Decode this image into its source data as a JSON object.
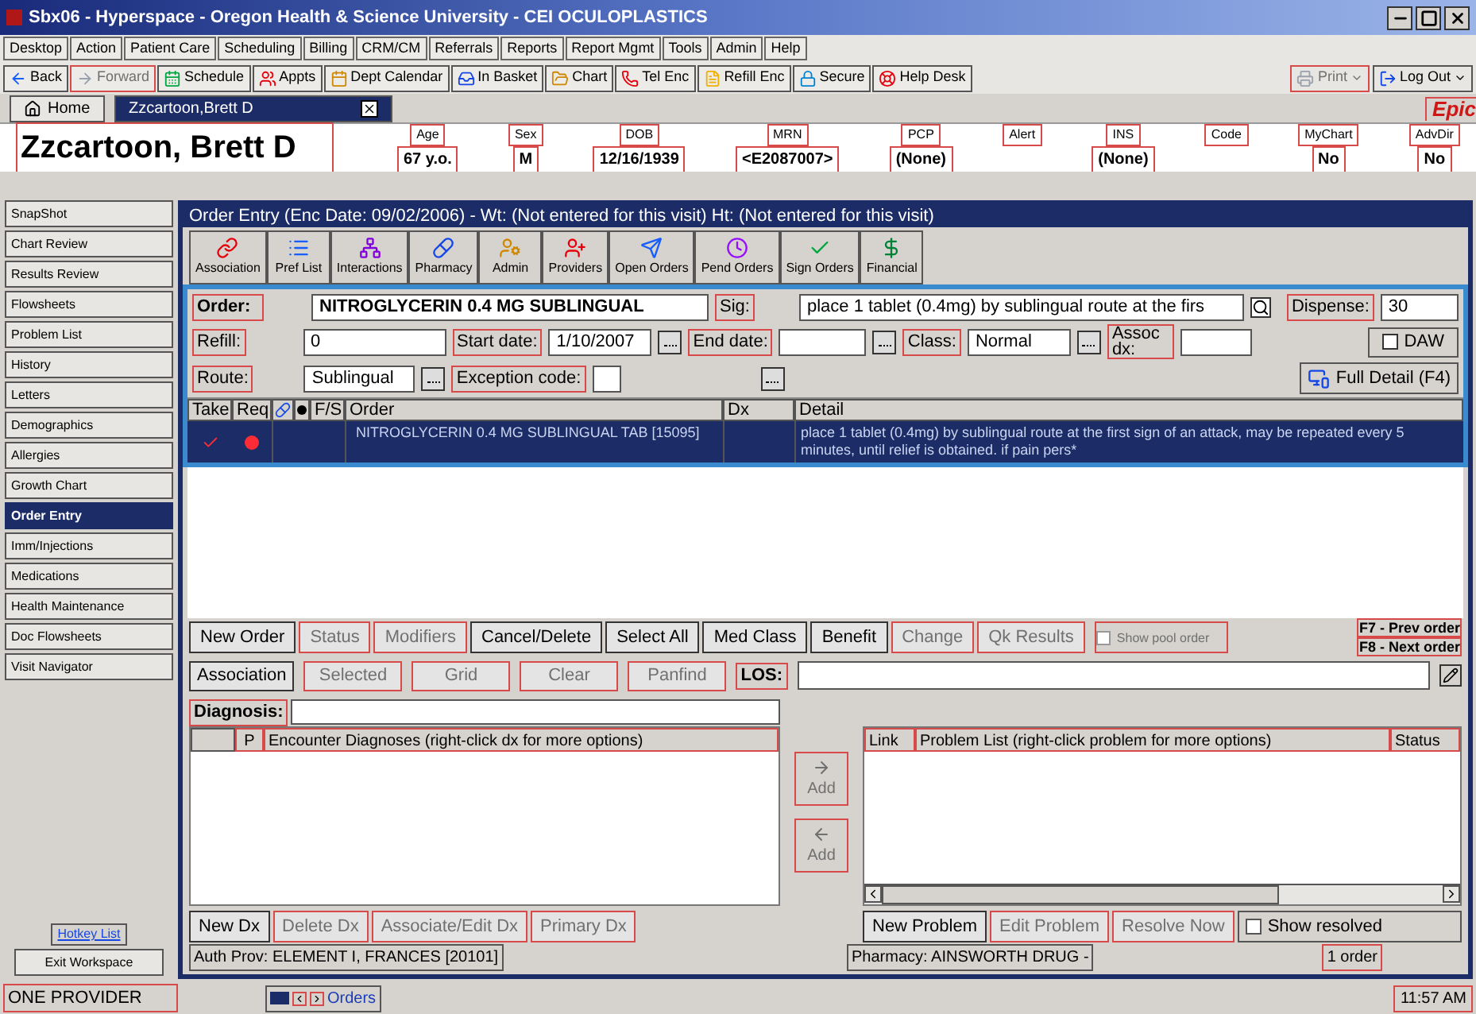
{
  "window": {
    "title": "Sbx06 - Hyperspace - Oregon Health & Science University - CEI OCULOPLASTICS"
  },
  "menu": [
    "Desktop",
    "Action",
    "Patient Care",
    "Scheduling",
    "Billing",
    "CRM/CM",
    "Referrals",
    "Reports",
    "Report Mgmt",
    "Tools",
    "Admin",
    "Help"
  ],
  "toolbar": [
    {
      "label": "Back",
      "disabled": false
    },
    {
      "label": "Forward",
      "disabled": true
    },
    {
      "label": "Schedule",
      "disabled": false
    },
    {
      "label": "Appts",
      "disabled": false
    },
    {
      "label": "Dept Calendar",
      "disabled": false
    },
    {
      "label": "In Basket",
      "disabled": false
    },
    {
      "label": "Chart",
      "disabled": false
    },
    {
      "label": "Tel Enc",
      "disabled": false
    },
    {
      "label": "Refill Enc",
      "disabled": false
    },
    {
      "label": "Secure",
      "disabled": false
    },
    {
      "label": "Help Desk",
      "disabled": false
    }
  ],
  "toolbar_right": [
    {
      "label": "Print",
      "disabled": true
    },
    {
      "label": "Log Out",
      "disabled": false
    }
  ],
  "logo": "Epic",
  "tabs": [
    {
      "label": "Home",
      "selected": false
    },
    {
      "label": "Zzcartoon,Brett D",
      "selected": true
    }
  ],
  "patient": {
    "name": "Zzcartoon, Brett D",
    "fields": [
      {
        "label": "Age",
        "value": "67 y.o."
      },
      {
        "label": "Sex",
        "value": "M"
      },
      {
        "label": "DOB",
        "value": "12/16/1939"
      },
      {
        "label": "MRN",
        "value": "<E2087007>"
      },
      {
        "label": "PCP",
        "value": "(None)"
      },
      {
        "label": "Alert"
      },
      {
        "label": "INS",
        "value": "(None)"
      },
      {
        "label": "Code"
      },
      {
        "label": "MyChart",
        "value": "No"
      },
      {
        "label": "AdvDir",
        "value": "No"
      }
    ]
  },
  "sidebar": {
    "items": [
      {
        "label": "SnapShot",
        "selected": false
      },
      {
        "label": "Chart Review",
        "selected": false
      },
      {
        "label": "Results Review",
        "selected": false
      },
      {
        "label": "Flowsheets",
        "selected": false
      },
      {
        "label": "Problem List",
        "selected": false
      },
      {
        "label": "History",
        "selected": false
      },
      {
        "label": "Letters",
        "selected": false
      },
      {
        "label": "Demographics",
        "selected": false
      },
      {
        "label": "Allergies",
        "selected": false
      },
      {
        "label": "Growth Chart",
        "selected": false
      },
      {
        "label": "Order Entry",
        "selected": true
      },
      {
        "label": "Imm/Injections",
        "selected": false
      },
      {
        "label": "Medications",
        "selected": false
      },
      {
        "label": "Health Maintenance",
        "selected": false
      },
      {
        "label": "Doc Flowsheets",
        "selected": false
      },
      {
        "label": "Visit Navigator",
        "selected": false
      }
    ],
    "hotkey_link": "Hotkey List",
    "exit_button": "Exit Workspace"
  },
  "activity": {
    "header": "Order Entry (Enc Date: 09/02/2006) - Wt: (Not entered for this visit) Ht: (Not entered for this visit)",
    "toolbar": [
      "Association",
      "Pref List",
      "Interactions",
      "Pharmacy",
      "Admin",
      "Providers",
      "Open Orders",
      "Pend Orders",
      "Sign Orders",
      "Financial"
    ]
  },
  "order_form": {
    "order_label": "Order:",
    "order_value": "NITROGLYCERIN 0.4 MG SUBLINGUAL",
    "sig_label": "Sig:",
    "sig_value": "place 1 tablet (0.4mg) by sublingual route at the firs",
    "dispense_label": "Dispense:",
    "dispense_value": "30",
    "refill_label": "Refill:",
    "refill_value": "0",
    "start_label": "Start date:",
    "start_value": "1/10/2007",
    "end_label": "End date:",
    "class_label": "Class:",
    "class_value": "Normal",
    "assoc_label": "Assoc dx:",
    "daw": {
      "label": "DAW",
      "checked": false
    },
    "route_label": "Route:",
    "route_value": "Sublingual",
    "exception_label": "Exception code:",
    "full_detail": "Full Detail (F4)"
  },
  "orders_table": {
    "columns": [
      "Take",
      "Req",
      "F/S",
      "Order",
      "Dx",
      "Detail"
    ],
    "rows": [
      {
        "order": "NITROGLYCERIN 0.4 MG SUBLINGUAL TAB [15095]",
        "detail": "place 1 tablet (0.4mg) by sublingual route at the first sign of an attack, may be repeated every 5 minutes, until relief is obtained. if pain pers*",
        "take": true,
        "required": true,
        "selected": true
      }
    ]
  },
  "order_buttons": [
    {
      "label": "New Order",
      "disabled": false
    },
    {
      "label": "Status",
      "disabled": true
    },
    {
      "label": "Modifiers",
      "disabled": true
    },
    {
      "label": "Cancel/Delete",
      "disabled": false
    },
    {
      "label": "Select All",
      "disabled": false
    },
    {
      "label": "Med Class",
      "disabled": false
    },
    {
      "label": "Benefit",
      "disabled": false
    },
    {
      "label": "Change",
      "disabled": true
    },
    {
      "label": "Qk Results",
      "disabled": true
    }
  ],
  "show_pool": {
    "label": "Show pool order",
    "checked": false,
    "disabled": true
  },
  "hints": [
    "F7 - Prev order",
    "F8 - Next order"
  ],
  "association_buttons": [
    {
      "label": "Association",
      "disabled": false
    },
    {
      "label": "Selected",
      "disabled": true
    },
    {
      "label": "Grid",
      "disabled": true
    },
    {
      "label": "Clear",
      "disabled": true
    },
    {
      "label": "Panfind",
      "disabled": true
    }
  ],
  "los_label": "LOS:",
  "diagnosis": {
    "label": "Diagnosis:",
    "columns": [
      "P",
      "Encounter Diagnoses (right-click dx for more options)"
    ],
    "add_buttons": [
      {
        "label": "Add",
        "disabled": true
      },
      {
        "label": "Add",
        "disabled": true
      }
    ],
    "buttons": [
      {
        "label": "New Dx",
        "disabled": false
      },
      {
        "label": "Delete Dx",
        "disabled": true
      },
      {
        "label": "Associate/Edit Dx",
        "disabled": true
      },
      {
        "label": "Primary Dx",
        "disabled": true
      }
    ],
    "auth_prov": "Auth Prov: ELEMENT I, FRANCES [20101]"
  },
  "problems": {
    "columns": [
      "Link",
      "Problem List (right-click problem for more options)",
      "Status"
    ],
    "buttons": [
      {
        "label": "New Problem",
        "disabled": false
      },
      {
        "label": "Edit Problem",
        "disabled": true
      },
      {
        "label": "Resolve Now",
        "disabled": true
      }
    ],
    "show_resolved": {
      "label": "Show resolved",
      "checked": false
    },
    "pharmacy": "Pharmacy: AINSWORTH DRUG -",
    "count": "1 order"
  },
  "status_bar": {
    "left": "ONE PROVIDER",
    "task": "Orders",
    "time": "11:57 AM"
  }
}
